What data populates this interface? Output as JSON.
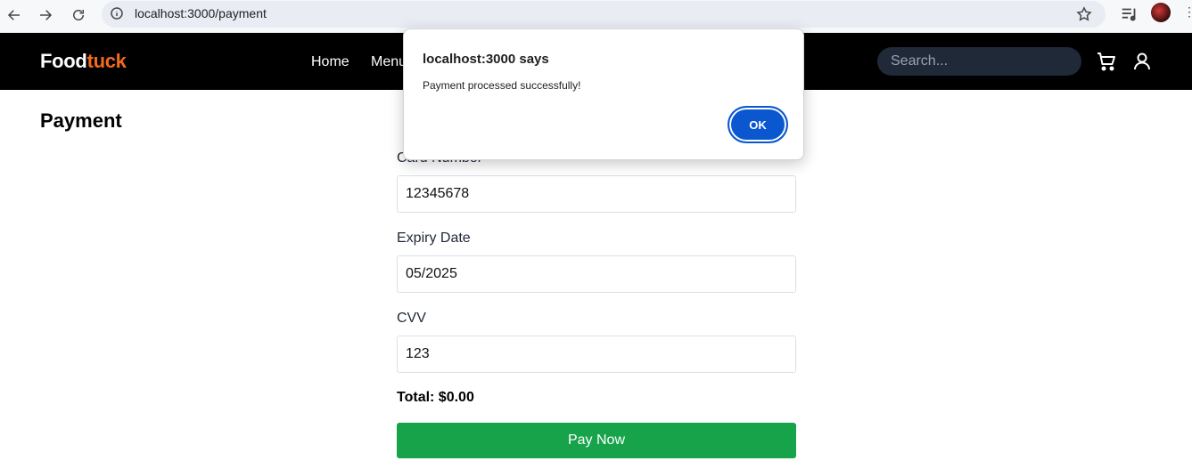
{
  "browser": {
    "url": "localhost:3000/payment"
  },
  "header": {
    "logo_part1": "Food",
    "logo_part2": "tuck",
    "nav": [
      {
        "label": "Home"
      },
      {
        "label": "Menu"
      }
    ],
    "search_placeholder": "Search..."
  },
  "page": {
    "title": "Payment",
    "card_number_label": "Card Number",
    "card_number_value": "12345678",
    "expiry_label": "Expiry Date",
    "expiry_value": "05/2025",
    "cvv_label": "CVV",
    "cvv_value": "123",
    "total": "Total: $0.00",
    "pay_button": "Pay Now"
  },
  "dialog": {
    "title": "localhost:3000 says",
    "message": "Payment processed successfully!",
    "ok_label": "OK"
  },
  "colors": {
    "header_bg": "#000000",
    "logo_accent": "#f26a1b",
    "pay_button": "#16a34a",
    "dialog_button": "#0b57d0"
  }
}
